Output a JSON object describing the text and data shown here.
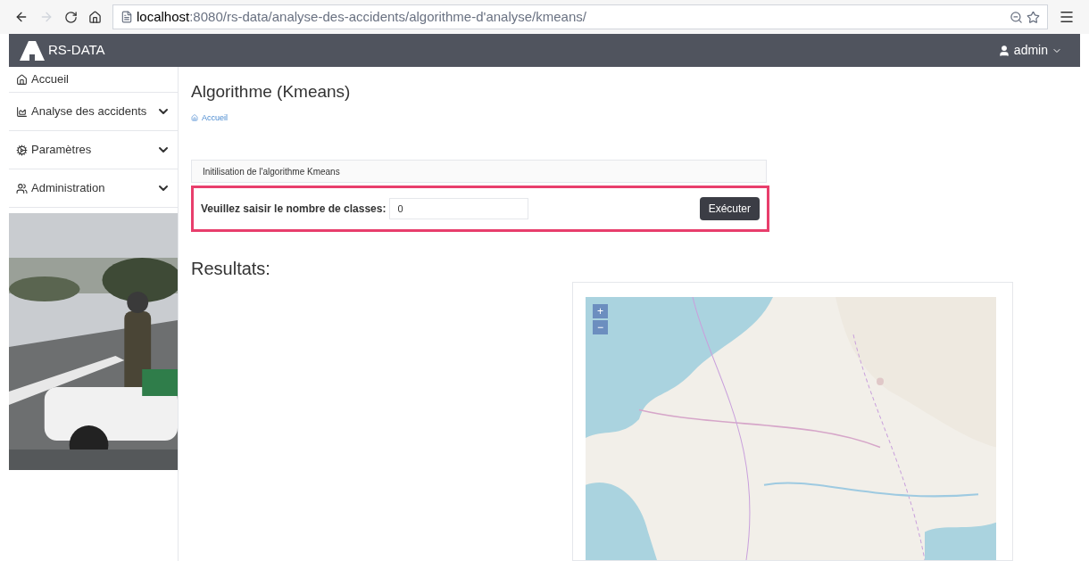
{
  "browser": {
    "url_host": "localhost",
    "url_path": ":8080/rs-data/analyse-des-accidents/algorithme-d'analyse/kmeans/"
  },
  "navbar": {
    "brand": "RS-DATA",
    "user": "admin"
  },
  "sidebar": {
    "items": [
      {
        "label": "Accueil",
        "kind": "link"
      },
      {
        "label": "Analyse des accidents",
        "kind": "menu"
      },
      {
        "label": "Paramètres",
        "kind": "menu"
      },
      {
        "label": "Administration",
        "kind": "menu"
      }
    ]
  },
  "page": {
    "title": "Algorithme (Kmeans)",
    "breadcrumb": "Accueil"
  },
  "form": {
    "heading": "Initilisation de l'algorithme Kmeans",
    "label": "Veuillez saisir le nombre de classes:",
    "value": "0",
    "button": "Exécuter"
  },
  "results": {
    "title": "Resultats:",
    "map": {
      "zoom_in": "+",
      "zoom_out": "−"
    }
  }
}
